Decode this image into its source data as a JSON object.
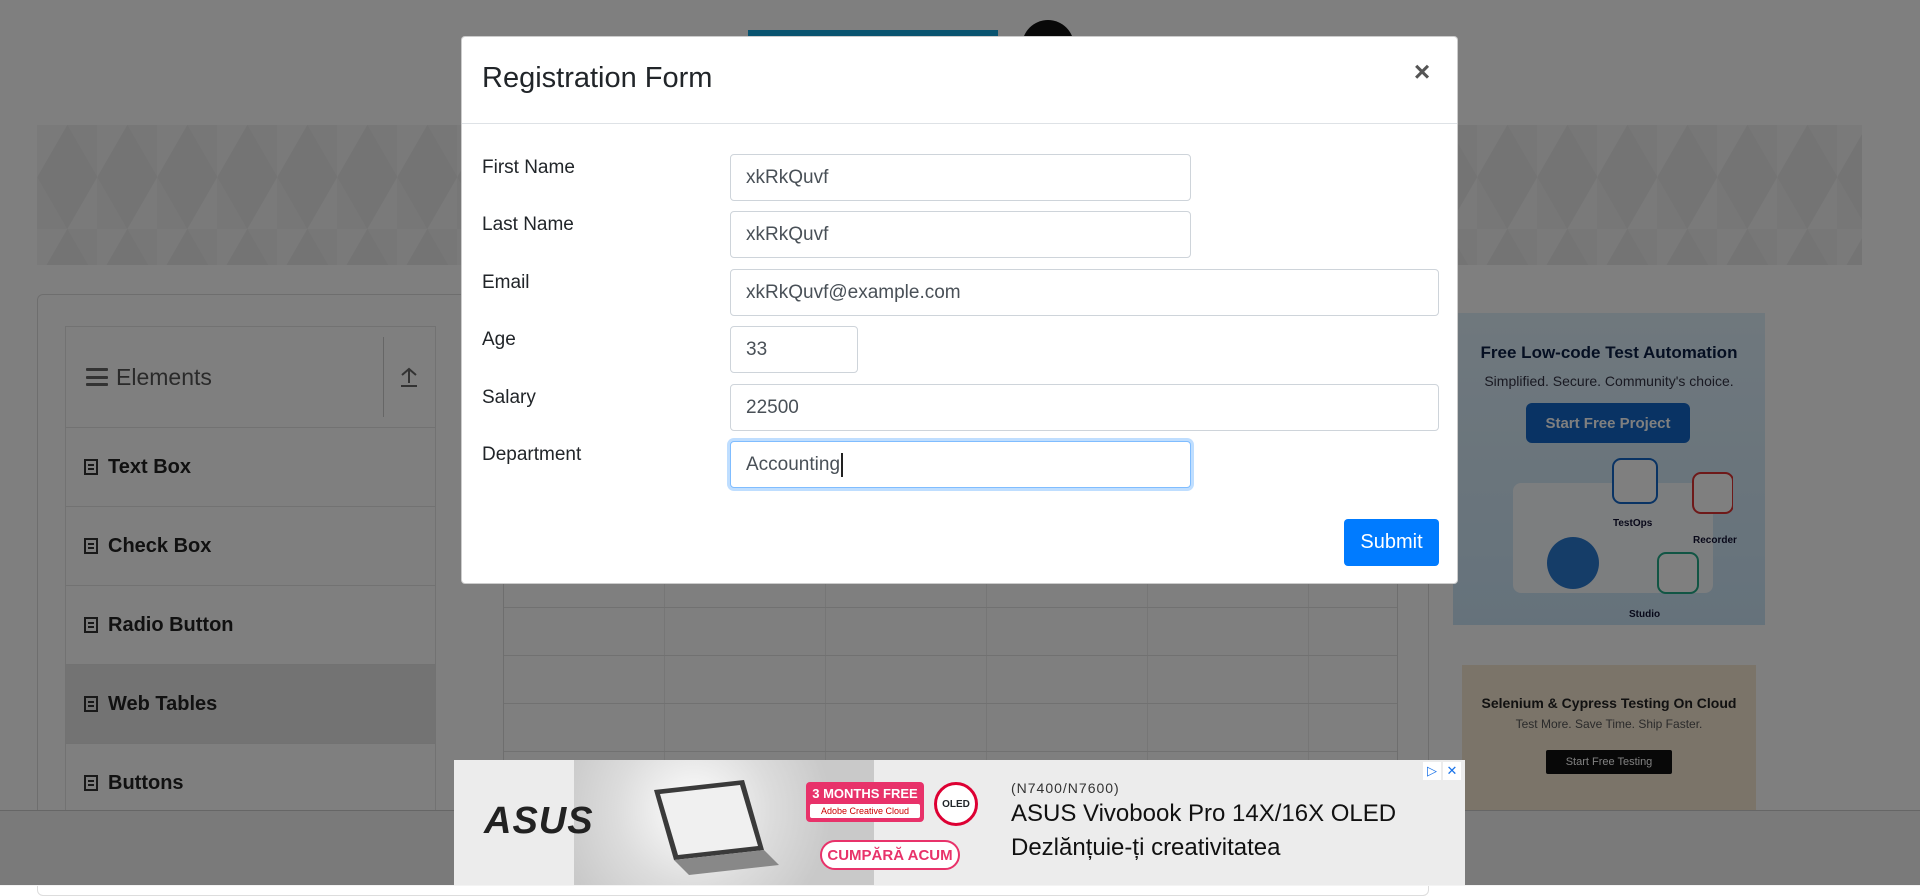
{
  "sidebar": {
    "group_title": "Elements",
    "items": [
      {
        "label": "Text Box"
      },
      {
        "label": "Check Box"
      },
      {
        "label": "Radio Button"
      },
      {
        "label": "Web Tables",
        "active": true
      },
      {
        "label": "Buttons"
      }
    ]
  },
  "right_ads": {
    "ad1": {
      "title": "Free Low-code Test Automation",
      "subtitle": "Simplified. Secure. Community's choice.",
      "button": "Start Free Project",
      "labels": [
        "TestOps",
        "Recorder",
        "Studio"
      ]
    },
    "ad2": {
      "title": "Selenium & Cypress Testing On Cloud",
      "subtitle": "Test More. Save Time. Ship Faster.",
      "button": "Start Free Testing"
    }
  },
  "modal": {
    "title": "Registration Form",
    "close_symbol": "×",
    "fields": {
      "first_name": {
        "label": "First Name",
        "value": "xkRkQuvf"
      },
      "last_name": {
        "label": "Last Name",
        "value": "xkRkQuvf"
      },
      "email": {
        "label": "Email",
        "value": "xkRkQuvf@example.com"
      },
      "age": {
        "label": "Age",
        "value": "33"
      },
      "salary": {
        "label": "Salary",
        "value": "22500"
      },
      "department": {
        "label": "Department",
        "value": "Accounting"
      }
    },
    "submit_label": "Submit"
  },
  "bottom_ad": {
    "brand": "ASUS",
    "promo": "3 MONTHS FREE",
    "promo_partner": "Adobe Creative Cloud",
    "badge": "OLED",
    "cta": "CUMPĂRĂ ACUM",
    "model": "(N7400/N7600)",
    "headline": "ASUS Vivobook Pro 14X/16X OLED",
    "tagline": "Dezlănțuie-ți creativitatea"
  },
  "colors": {
    "primary": "#007bff",
    "focus_border": "#80bdff",
    "overlay": "rgba(0,0,0,0.5)",
    "promo_pink": "#e8326a"
  }
}
